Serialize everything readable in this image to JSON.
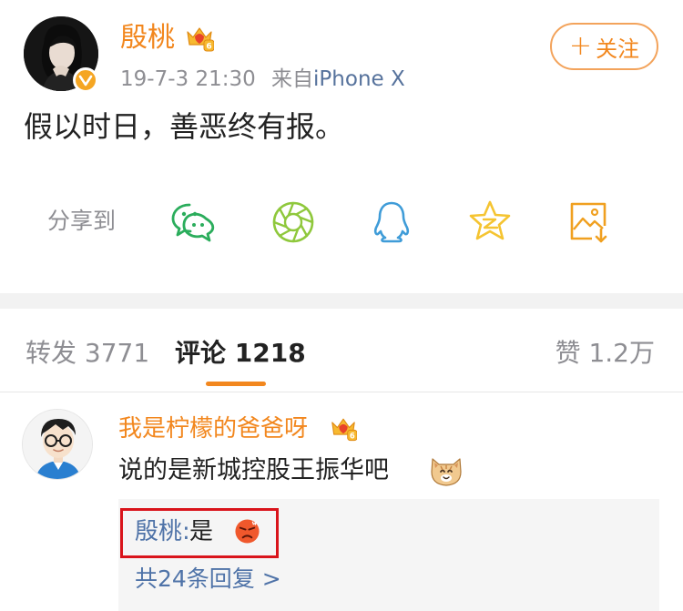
{
  "post": {
    "author": "殷桃",
    "date": "19-7-3 21:30",
    "source_prefix": "来自",
    "device": "iPhone X",
    "follow_label": "关注",
    "content": "假以时日，善恶终有报。",
    "verified_icon": "verified-v-icon",
    "crown_icon": "vip-crown-icon"
  },
  "share": {
    "label": "分享到",
    "targets": [
      {
        "name": "wechat-icon",
        "color": "#2bad5c"
      },
      {
        "name": "moments-icon",
        "color": "#8fc83c"
      },
      {
        "name": "qq-icon",
        "color": "#3f9cd8"
      },
      {
        "name": "qzone-icon",
        "color": "#f5c431"
      },
      {
        "name": "save-image-icon",
        "color": "#f0a020"
      }
    ]
  },
  "tabs": {
    "repost": "转发 3771",
    "comment": "评论 1218",
    "like": "赞 1.2万"
  },
  "comment": {
    "author": "我是柠檬的爸爸呀",
    "text": "说的是新城控股王振华吧",
    "emoji": "cat-emoji",
    "reply": {
      "author": "殷桃",
      "separator": ":",
      "text": "是",
      "emoji": "angry-emoji"
    },
    "reply_count_label": "共24条回复 >"
  },
  "colors": {
    "accent": "#f2871e",
    "link": "#4f73a8",
    "muted": "#8e8e93",
    "highlight": "#d9141b"
  }
}
